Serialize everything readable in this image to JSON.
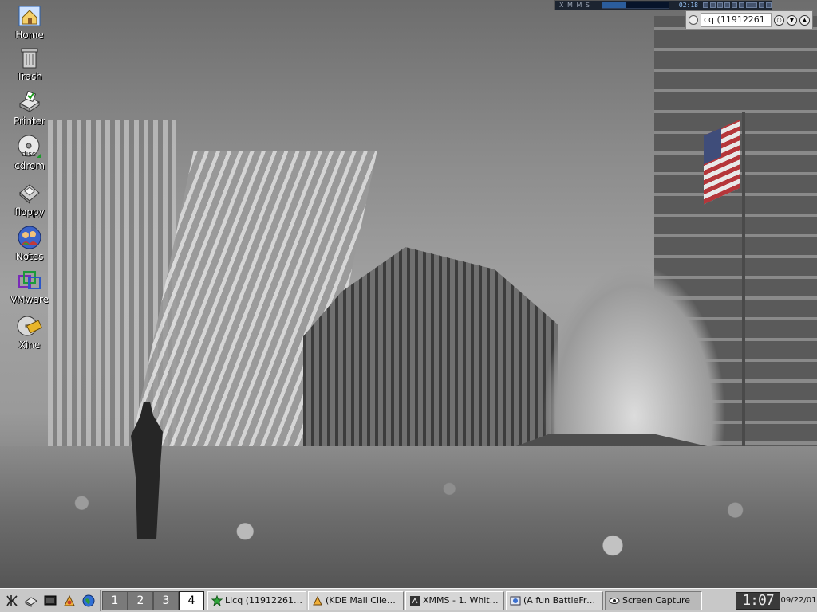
{
  "desktop": {
    "icons": [
      {
        "label": "Home",
        "icon": "home-icon"
      },
      {
        "label": "Trash",
        "icon": "trash-icon"
      },
      {
        "label": "Printer",
        "icon": "printer-icon"
      },
      {
        "label": "cdrom",
        "icon": "cdrom-icon"
      },
      {
        "label": "floppy",
        "icon": "floppy-icon"
      },
      {
        "label": "Notes",
        "icon": "notes-icon"
      },
      {
        "label": "VMware",
        "icon": "vmware-icon"
      },
      {
        "label": "Xine",
        "icon": "xine-icon"
      }
    ],
    "cdrom_disc_text": "disc"
  },
  "xmms": {
    "title": "X M M S",
    "time": "02:18",
    "progress": 0.35
  },
  "licq_applet": {
    "title": "cq (11912261"
  },
  "taskbar": {
    "launchers": [
      {
        "icon": "kde-menu-icon"
      },
      {
        "icon": "window-list-icon"
      },
      {
        "icon": "desktop-icon"
      },
      {
        "icon": "konqueror-icon"
      },
      {
        "icon": "globe-icon"
      }
    ],
    "pager": [
      "1",
      "2",
      "3",
      "4"
    ],
    "active_desktop": "4",
    "tasks": [
      {
        "label": "Licq (119122613)",
        "icon": "licq-icon",
        "active": false
      },
      {
        "label": "(KDE Mail Client - ...",
        "icon": "kmail-icon",
        "active": false
      },
      {
        "label": "XMMS - 1. White Z...",
        "icon": "xmms-icon",
        "active": false
      },
      {
        "label": "(A fun BattleFront ...",
        "icon": "browser-icon",
        "active": false
      },
      {
        "label": "Screen Capture",
        "icon": "eye-icon",
        "active": true
      }
    ],
    "clock": "1:07",
    "date": "09/22/01"
  },
  "colors": {
    "taskbar_bg": "#c8c8c8",
    "pager_inactive": "#7a7a7a",
    "xmms_bg": "#1c2430",
    "clock_bg": "#3a3a3a"
  }
}
